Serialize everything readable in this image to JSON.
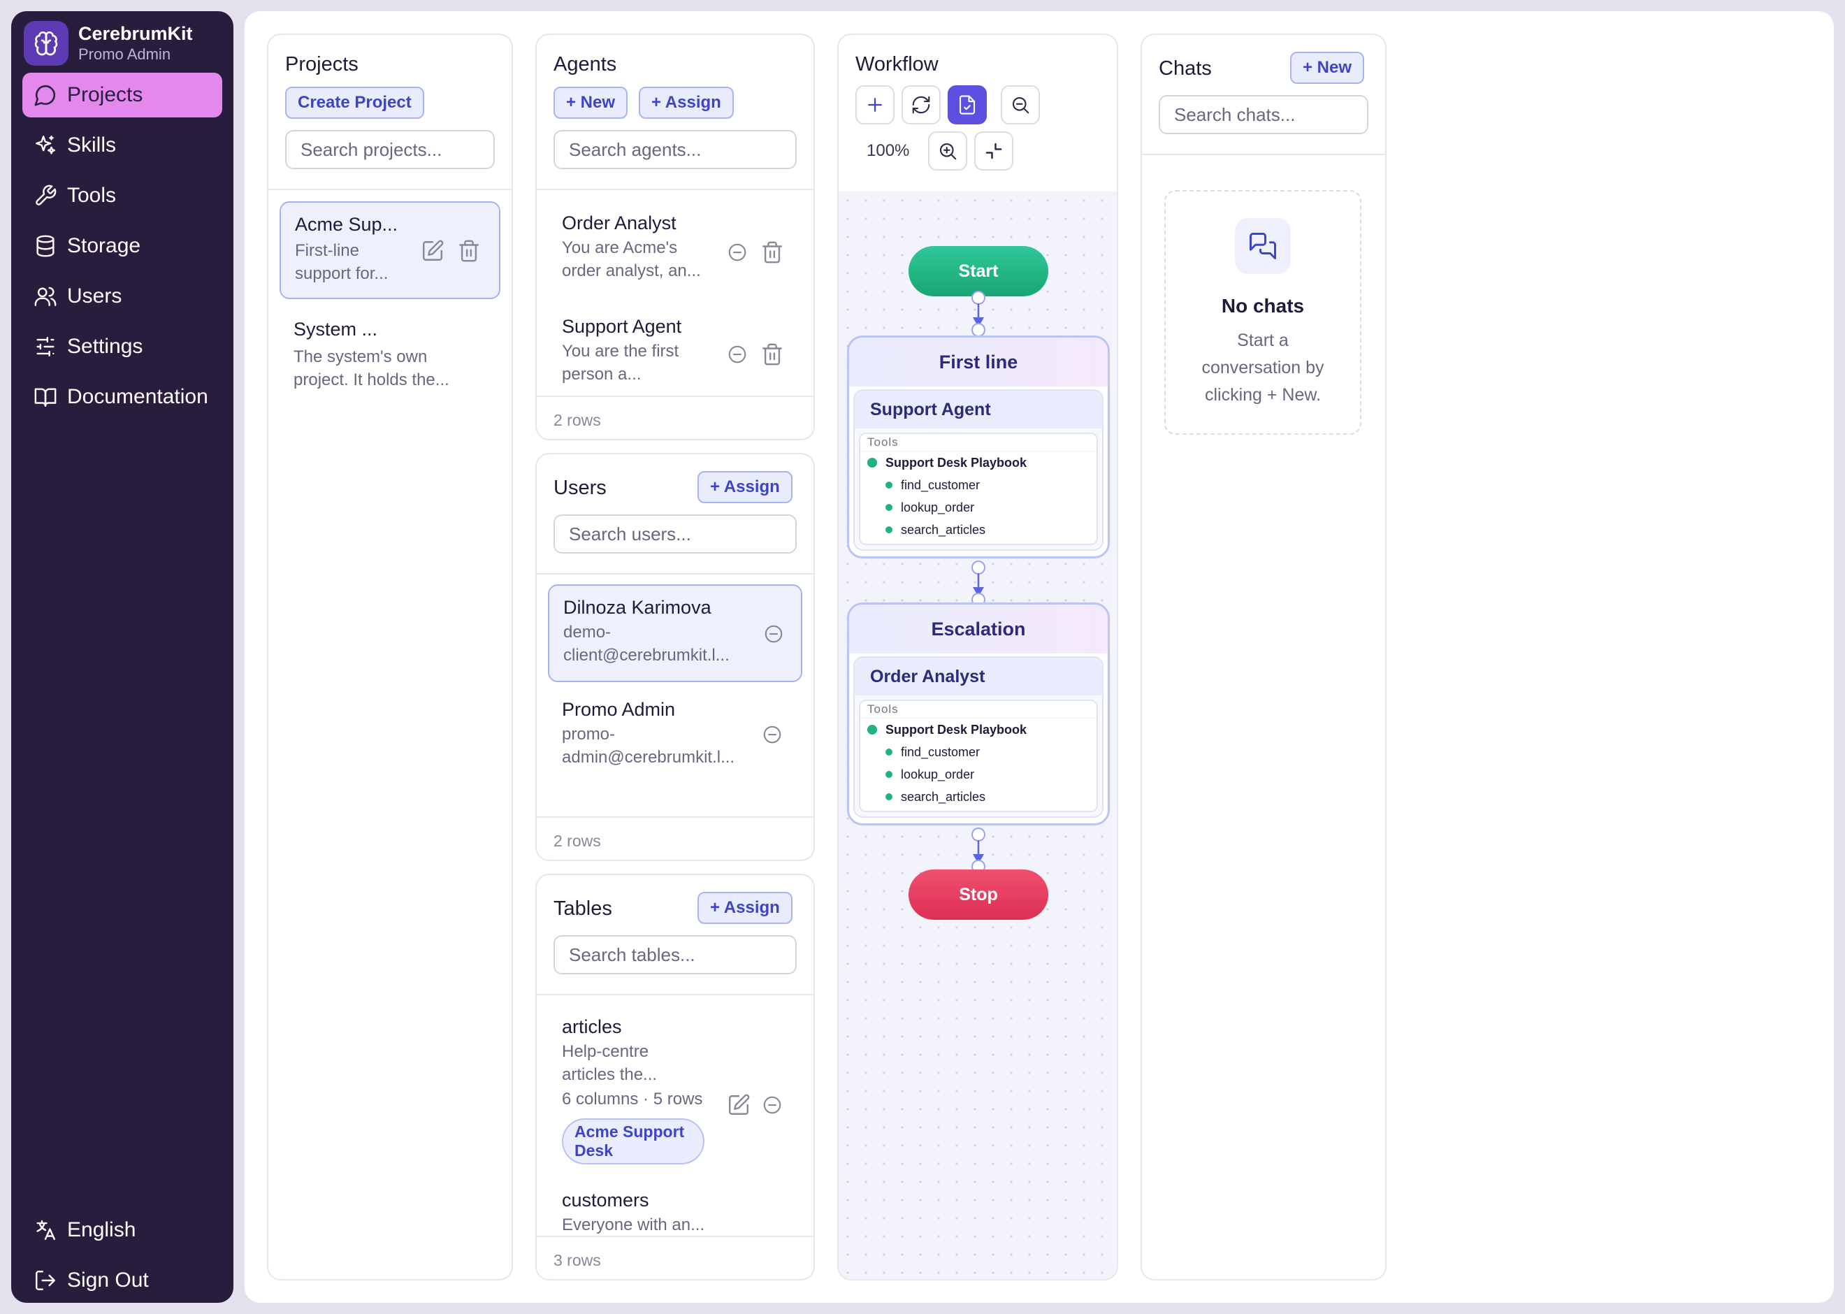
{
  "brand": {
    "name": "CerebrumKit",
    "sub": "Promo Admin",
    "icon": "brain-icon"
  },
  "nav": {
    "items": [
      {
        "label": "Projects",
        "icon": "chat-icon",
        "active": true
      },
      {
        "label": "Skills",
        "icon": "sparkles-icon"
      },
      {
        "label": "Tools",
        "icon": "wrench-icon"
      },
      {
        "label": "Storage",
        "icon": "database-icon"
      },
      {
        "label": "Users",
        "icon": "users-icon"
      },
      {
        "label": "Settings",
        "icon": "sliders-icon"
      },
      {
        "label": "Documentation",
        "icon": "book-icon"
      }
    ],
    "language": "English",
    "sign_out": "Sign Out"
  },
  "colors": {
    "sidebar": "#271e3d",
    "active_nav": "#e488ee",
    "accent": "#3e44c8",
    "start": "#1fb380",
    "stop": "#e83a5f"
  },
  "projects": {
    "title": "Projects",
    "create_label": "Create Project",
    "search_placeholder": "Search projects...",
    "items": [
      {
        "name": "Acme Sup...",
        "desc": "First-line support for...",
        "selected": true
      },
      {
        "name": "System ...",
        "desc": "The system's own project. It holds the..."
      }
    ]
  },
  "agents": {
    "title": "Agents",
    "new_label": "+ New",
    "assign_label": "+ Assign",
    "search_placeholder": "Search agents...",
    "items": [
      {
        "name": "Order Analyst",
        "desc": "You are Acme's order analyst, an..."
      },
      {
        "name": "Support Agent",
        "desc": "You are the first person a..."
      }
    ],
    "rows": "2 rows"
  },
  "users": {
    "title": "Users",
    "assign_label": "+ Assign",
    "search_placeholder": "Search users...",
    "items": [
      {
        "name": "Dilnoza Karimova",
        "email": "demo-client@cerebrumkit.l...",
        "selected": true
      },
      {
        "name": "Promo Admin",
        "email": "promo-admin@cerebrumkit.l..."
      }
    ],
    "rows": "2 rows"
  },
  "tables": {
    "title": "Tables",
    "assign_label": "+ Assign",
    "search_placeholder": "Search tables...",
    "items": [
      {
        "name": "articles",
        "desc": "Help-centre articles the...",
        "meta": "6 columns · 5 rows",
        "tag": "Acme Support Desk"
      },
      {
        "name": "customers",
        "desc": "Everyone with an..."
      }
    ],
    "rows": "3 rows"
  },
  "workflow": {
    "title": "Workflow",
    "zoom": "100%",
    "start": "Start",
    "stop": "Stop",
    "tools_label": "Tools",
    "stages": [
      {
        "name": "First line",
        "agent": "Support Agent",
        "skill": "Support Desk Playbook",
        "tools": [
          "find_customer",
          "lookup_order",
          "search_articles"
        ]
      },
      {
        "name": "Escalation",
        "agent": "Order Analyst",
        "skill": "Support Desk Playbook",
        "tools": [
          "find_customer",
          "lookup_order",
          "search_articles"
        ]
      }
    ]
  },
  "chats": {
    "title": "Chats",
    "new_label": "+ New",
    "search_placeholder": "Search chats...",
    "empty_title": "No chats",
    "empty_desc": "Start a conversation by clicking + New."
  }
}
